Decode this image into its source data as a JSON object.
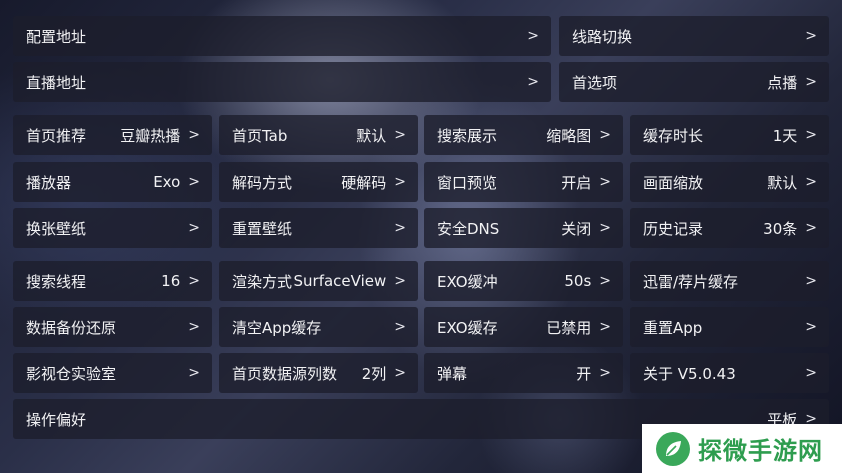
{
  "settings": [
    {
      "label": "配置地址",
      "value": "",
      "chevron": ">"
    },
    {
      "label": "线路切换",
      "value": "",
      "chevron": ">"
    },
    {
      "label": "直播地址",
      "value": "",
      "chevron": ">"
    },
    {
      "label": "首选项",
      "value": "点播",
      "chevron": ">"
    },
    {
      "label": "首页推荐",
      "value": "豆瓣热播",
      "chevron": ">"
    },
    {
      "label": "首页Tab",
      "value": "默认",
      "chevron": ">"
    },
    {
      "label": "搜索展示",
      "value": "缩略图",
      "chevron": ">"
    },
    {
      "label": "缓存时长",
      "value": "1天",
      "chevron": ">"
    },
    {
      "label": "播放器",
      "value": "Exo",
      "chevron": ">"
    },
    {
      "label": "解码方式",
      "value": "硬解码",
      "chevron": ">"
    },
    {
      "label": "窗口预览",
      "value": "开启",
      "chevron": ">"
    },
    {
      "label": "画面缩放",
      "value": "默认",
      "chevron": ">"
    },
    {
      "label": "换张壁纸",
      "value": "",
      "chevron": ">"
    },
    {
      "label": "重置壁纸",
      "value": "",
      "chevron": ">"
    },
    {
      "label": "安全DNS",
      "value": "关闭",
      "chevron": ">"
    },
    {
      "label": "历史记录",
      "value": "30条",
      "chevron": ">"
    },
    {
      "label": "搜索线程",
      "value": "16",
      "chevron": ">"
    },
    {
      "label": "渲染方式",
      "value": "SurfaceView",
      "chevron": ">"
    },
    {
      "label": "EXO缓冲",
      "value": "50s",
      "chevron": ">"
    },
    {
      "label": "迅雷/荐片缓存",
      "value": "",
      "chevron": ">"
    },
    {
      "label": "数据备份还原",
      "value": "",
      "chevron": ">"
    },
    {
      "label": "清空App缓存",
      "value": "",
      "chevron": ">"
    },
    {
      "label": "EXO缓存",
      "value": "已禁用",
      "chevron": ">"
    },
    {
      "label": "重置App",
      "value": "",
      "chevron": ">"
    },
    {
      "label": "影视仓实验室",
      "value": "",
      "chevron": ">"
    },
    {
      "label": "首页数据源列数",
      "value": "2列",
      "chevron": ">"
    },
    {
      "label": "弹幕",
      "value": "开",
      "chevron": ">"
    },
    {
      "label": "关于 V5.0.43",
      "value": "",
      "chevron": ">"
    },
    {
      "label": "操作偏好",
      "value": "平板",
      "chevron": ">"
    }
  ],
  "watermark": {
    "text": "探微手游网"
  }
}
